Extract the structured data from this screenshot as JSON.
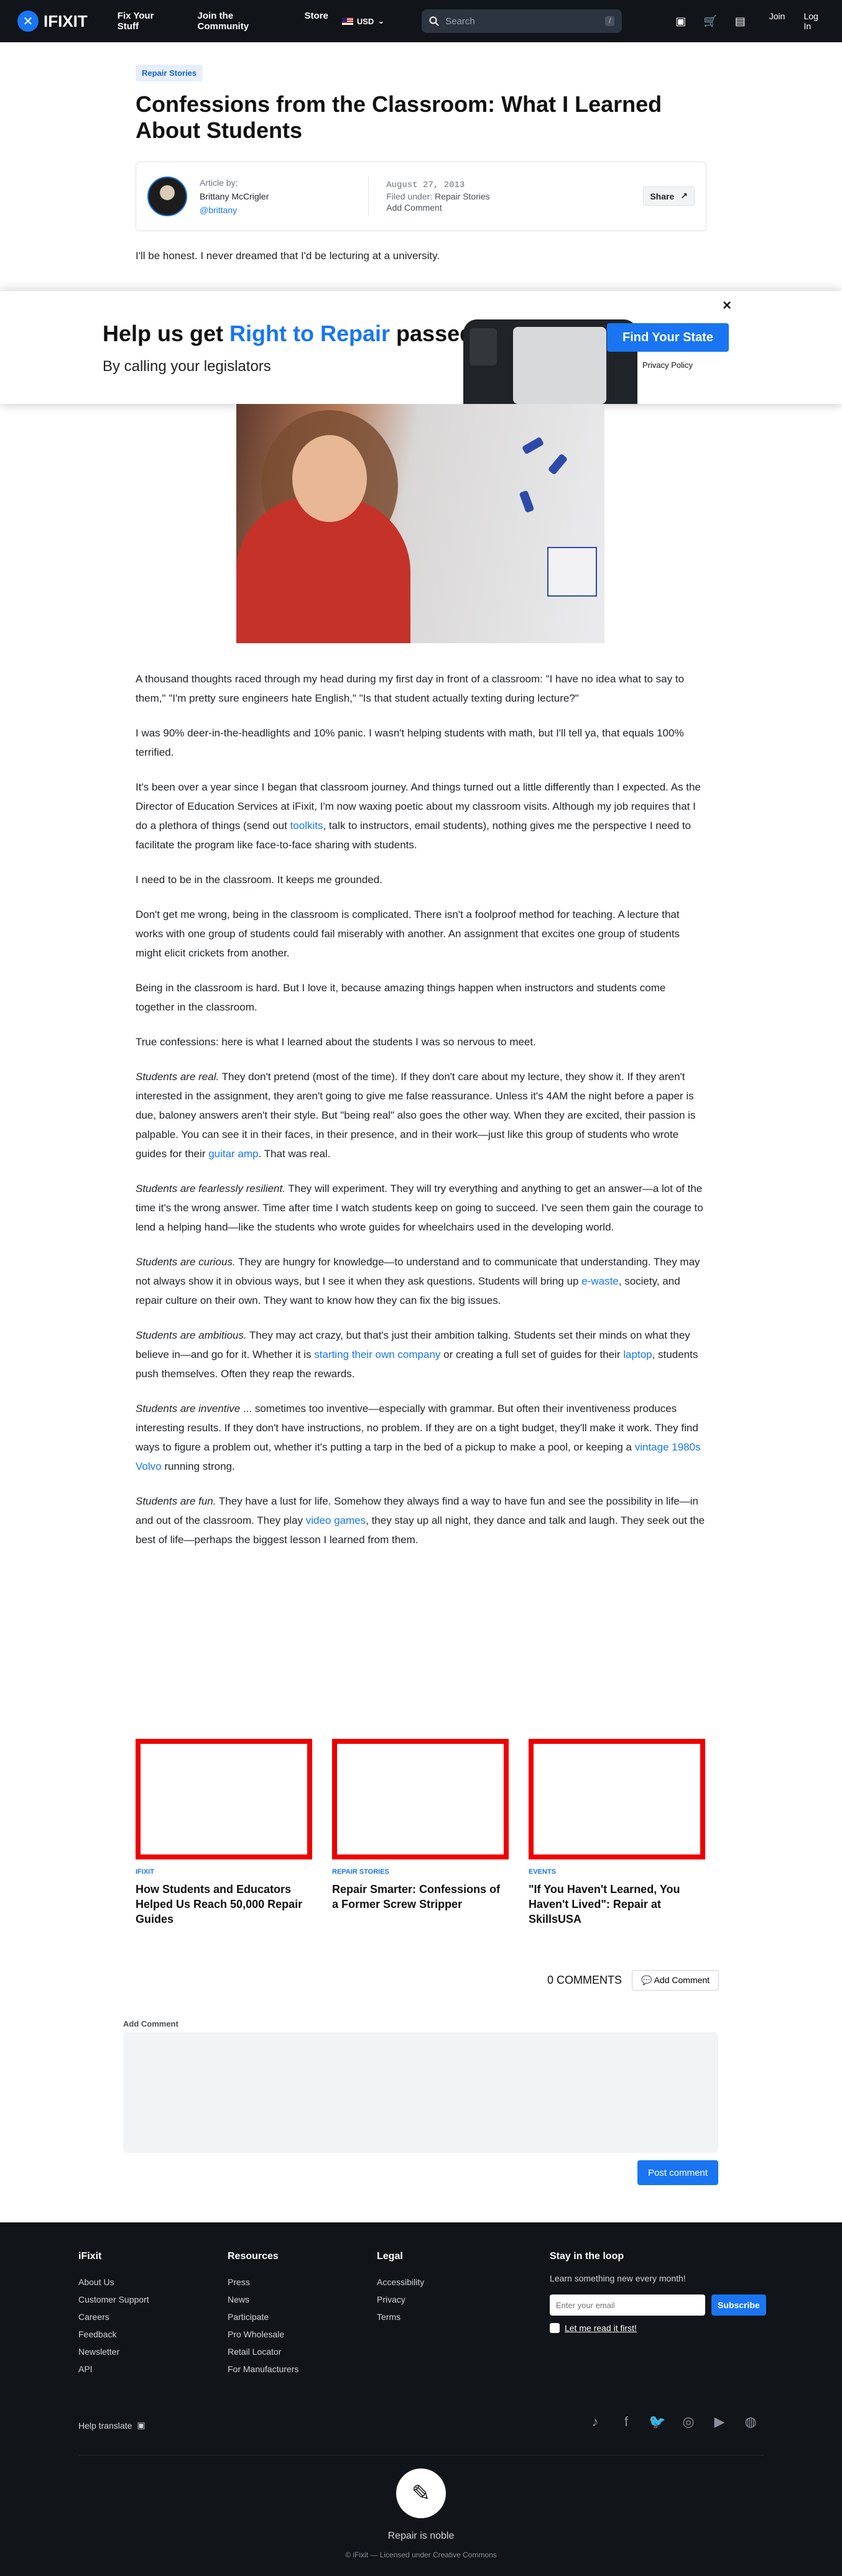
{
  "nav": {
    "brand": "IFIXIT",
    "links": [
      "Fix Your Stuff",
      "Join the Community",
      "Store"
    ],
    "locale": "USD",
    "search_placeholder": "Search",
    "search_shortcut": "/",
    "join": "Join",
    "login": "Log In"
  },
  "article": {
    "tag": "Repair Stories",
    "title": "Confessions from the Classroom: What I Learned About Students",
    "author_label": "Article by:",
    "author_name": "Brittany McCrigler",
    "author_handle": "@brittany",
    "date": "August 27, 2013",
    "filed_label": "Filed under:",
    "filed_value": "Repair Stories",
    "add_comment": "Add Comment",
    "share": "Share",
    "intro": "I'll be honest. I never dreamed that I'd be lecturing at a university."
  },
  "banner": {
    "title_pre": "Help us get ",
    "title_hl": "Right to Repair",
    "title_post": " passed",
    "subtitle": "By calling your legislators",
    "cta": "Find Your State",
    "privacy": "Privacy Policy",
    "close": "×"
  },
  "body": [
    "A thousand thoughts raced through my head during my first day in front of a classroom: \"I have no idea what to say to them,\" \"I'm pretty sure engineers hate English,\" \"Is that student actually texting during lecture?\"",
    "I was 90% deer-in-the-headlights and 10% panic. I wasn't helping students with math, but I'll tell ya, that equals 100% terrified."
  ],
  "p3": {
    "a": "It's been over a year since I began that classroom journey. And things turned out a little differently than I expected. As the Director of Education Services at iFixit, I'm now waxing poetic about my classroom visits. Although my job requires that I do a plethora of things (send out ",
    "link": "toolkits",
    "b": ", talk to instructors, email students), nothing gives me the perspective I need to facilitate the program like face-to-face sharing with students."
  },
  "body2": [
    "I need to be in the classroom. It keeps me grounded.",
    "Don't get me wrong, being in the classroom is complicated. There isn't a foolproof method for teaching. A lecture that works with one group of students could fail miserably with another. An assignment that excites one group of students might elicit crickets from another.",
    "Being in the classroom is hard. But I love it, because amazing things happen when instructors and students come together in the classroom.",
    "True confessions: here is what I learned about the students I was so nervous to meet."
  ],
  "real": {
    "em": "Students are real.",
    "a": " They don't pretend (most of the time). If they don't care about my lecture, they show it. If they aren't interested in the assignment, they aren't going to give me false reassurance. Unless it's 4AM the night before a paper is due, baloney answers aren't their style. But \"being real\" also goes the other way. When they are excited, their passion is palpable. You can see it in their faces, in their presence, and in their work—just like this group of students who wrote guides for their ",
    "link": "guitar amp",
    "b": ". That was real."
  },
  "resilient": {
    "em": "Students are fearlessly resilient.",
    "a": " They will experiment. They will try everything and anything to get an answer—a lot of the time it's the wrong answer. Time after time I watch students keep on going to succeed. I've seen them gain the courage to lend a helping hand—like the students who wrote guides for wheelchairs used in the developing world."
  },
  "curious": {
    "em": "Students are curious.",
    "a": " They are hungry for knowledge—to understand and to communicate that understanding. They may not always show it in obvious ways, but I see it when they ask questions. Students will bring up ",
    "link": "e-waste",
    "b": ", society, and repair culture on their own. They want to know how they can fix the big issues."
  },
  "ambitious": {
    "em": "Students are ambitious.",
    "a": "  They may act crazy, but that's just their ambition talking. Students set their minds on what they believe in—and go for it. Whether it is ",
    "link1": "starting their own company",
    "b": " or creating a full set of guides for their ",
    "link2": "laptop",
    "c": ", students push themselves. Often they reap the rewards."
  },
  "inventive": {
    "em": "Students are inventive",
    "a": " ... sometimes too inventive—especially with grammar. But often their inventiveness produces interesting results. If they don't have instructions, no problem. If they are on a tight budget, they'll make it work. They find ways to figure a problem out, whether it's putting a tarp in the bed of a pickup to make a pool, or keeping a ",
    "link": "vintage 1980s Volvo",
    "b": " running strong."
  },
  "fun": {
    "em": "Students are fun.",
    "a": " They have a lust for life. Somehow they always find a way to have fun and see the possibility in life—in and out of the classroom. They play ",
    "link": "video games",
    "b": ", they stay up all night, they dance and talk and laugh. They seek out the best of life—perhaps the biggest lesson I learned from them."
  },
  "related": [
    {
      "category": "IFIXIT",
      "title": "How Students and Educators Helped Us Reach 50,000 Repair Guides"
    },
    {
      "category": "REPAIR STORIES",
      "title": "Repair Smarter: Confessions of a Former Screw Stripper"
    },
    {
      "category": "EVENTS",
      "title": "\"If You Haven't Learned, You Haven't Lived\": Repair at SkillsUSA"
    }
  ],
  "comments": {
    "count": "0 COMMENTS",
    "add": "Add Comment",
    "label": "Add Comment",
    "post": "Post comment"
  },
  "footer": {
    "col1": {
      "head": "iFixit",
      "items": [
        "About Us",
        "Customer Support",
        "Careers",
        "Feedback",
        "Newsletter",
        "API"
      ]
    },
    "col2": {
      "head": "Resources",
      "items": [
        "Press",
        "News",
        "Participate",
        "Pro Wholesale",
        "Retail Locator",
        "For Manufacturers"
      ]
    },
    "col3": {
      "head": "Legal",
      "items": [
        "Accessibility",
        "Privacy",
        "Terms"
      ]
    },
    "newsletter": {
      "head": "Stay in the loop",
      "text": "Learn something new every month!",
      "placeholder": "Enter your email",
      "subscribe": "Subscribe",
      "link": "Let me read it first!"
    },
    "translate": "Help translate",
    "motto": "Repair is noble",
    "license": "© iFixit — Licensed under Creative Commons"
  },
  "colors": {
    "accent": "#1975f1",
    "nav_bg": "#111418",
    "thumb_border": "#e00000"
  }
}
